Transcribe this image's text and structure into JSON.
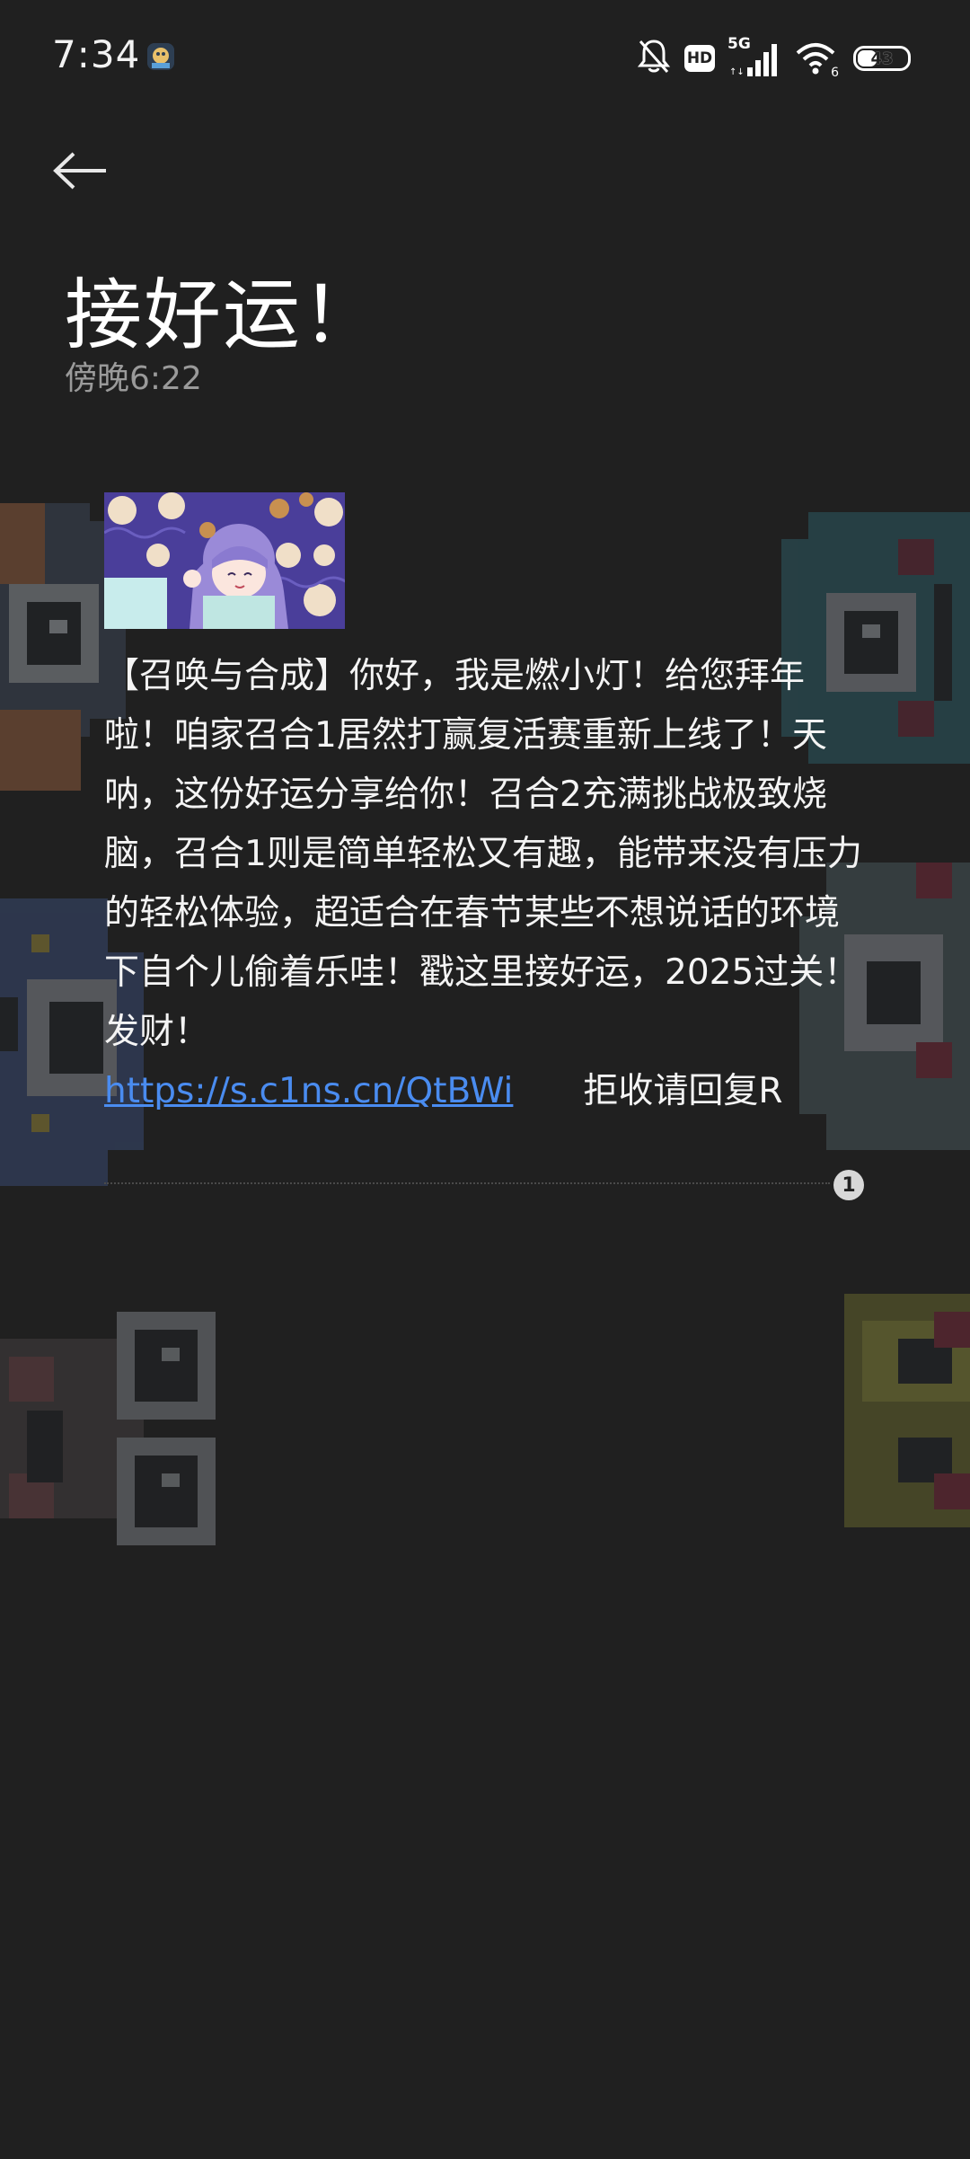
{
  "status_bar": {
    "time": "7:34",
    "network": "5G",
    "hd_label": "HD",
    "wifi_label": "6",
    "battery": "43",
    "battery_level": 0.43
  },
  "header": {
    "back_icon": "arrow-left-icon",
    "title": "接好运！",
    "timestamp": "傍晚6:22"
  },
  "message": {
    "body": "【召唤与合成】你好，我是燃小灯！给您拜年啦！咱家召合1居然打赢复活赛重新上线了！天呐，这份好运分享给你！召合2充满挑战极致烧脑，召合1则是简单轻松又有趣，能带来没有压力的轻松体验，超适合在春节某些不想说话的环境下自个儿偷着乐哇！戳这里接好运，2025过关！发财！",
    "link": "https://s.c1ns.cn/QtBWi",
    "unsubscribe": "拒收请回复R",
    "sim_slot": "1"
  },
  "colors": {
    "background": "#202020",
    "link": "#4a8cf0",
    "timestamp": "#9a9a9a"
  }
}
